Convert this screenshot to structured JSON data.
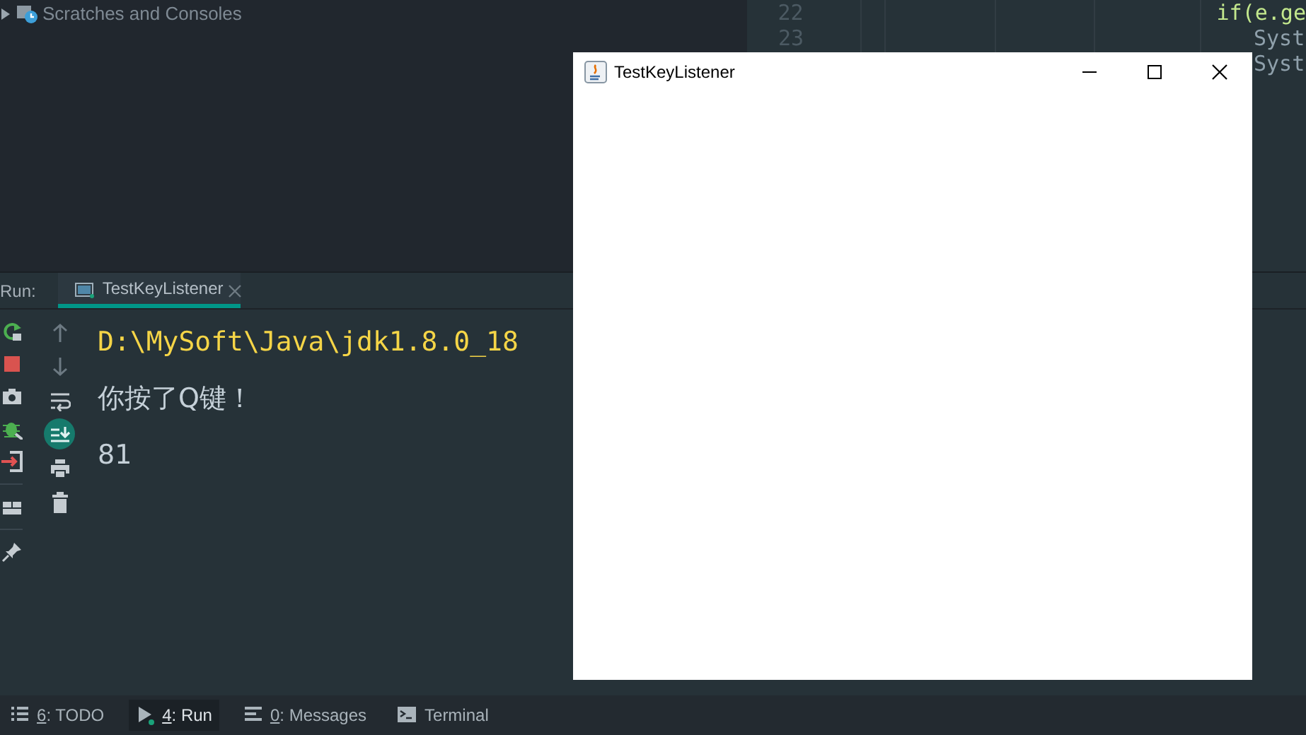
{
  "project_tree": {
    "items": [
      {
        "label": "Scratches and Consoles",
        "expanded": false
      }
    ]
  },
  "editor": {
    "lines": [
      {
        "number": "22",
        "code": "if(e.ge"
      },
      {
        "number": "23",
        "code": "Syst"
      },
      {
        "code": "Syst"
      }
    ]
  },
  "run_panel": {
    "label": "Run:",
    "tabs": [
      {
        "label": "TestKeyListener",
        "selected": true
      }
    ],
    "console": [
      {
        "kind": "command",
        "text": "D:\\MySoft\\Java\\jdk1.8.0_18"
      },
      {
        "kind": "output",
        "text": "你按了Q键！"
      },
      {
        "kind": "output",
        "text": "81"
      }
    ],
    "toolbar_left": [
      {
        "kind": "rerun"
      },
      {
        "kind": "stop"
      },
      {
        "kind": "camera"
      },
      {
        "kind": "debug"
      },
      {
        "kind": "exit"
      },
      {
        "kind": "layout"
      },
      {
        "kind": "pin"
      }
    ],
    "toolbar_right": [
      {
        "kind": "up",
        "on": false
      },
      {
        "kind": "down",
        "on": false
      },
      {
        "kind": "wrap",
        "on": false
      },
      {
        "kind": "scroll",
        "on": true
      },
      {
        "kind": "print",
        "on": false
      },
      {
        "kind": "trash",
        "on": false
      }
    ]
  },
  "app_window": {
    "title": "TestKeyListener"
  },
  "bottom_bar": [
    {
      "kind": "todo",
      "mnemonic": "6",
      "label": ": TODO",
      "selected": false
    },
    {
      "kind": "run",
      "mnemonic": "4",
      "label": ": Run",
      "selected": true
    },
    {
      "kind": "messages",
      "mnemonic": "0",
      "label": ": Messages",
      "selected": false
    },
    {
      "kind": "terminal",
      "label": "Terminal",
      "selected": false
    }
  ]
}
